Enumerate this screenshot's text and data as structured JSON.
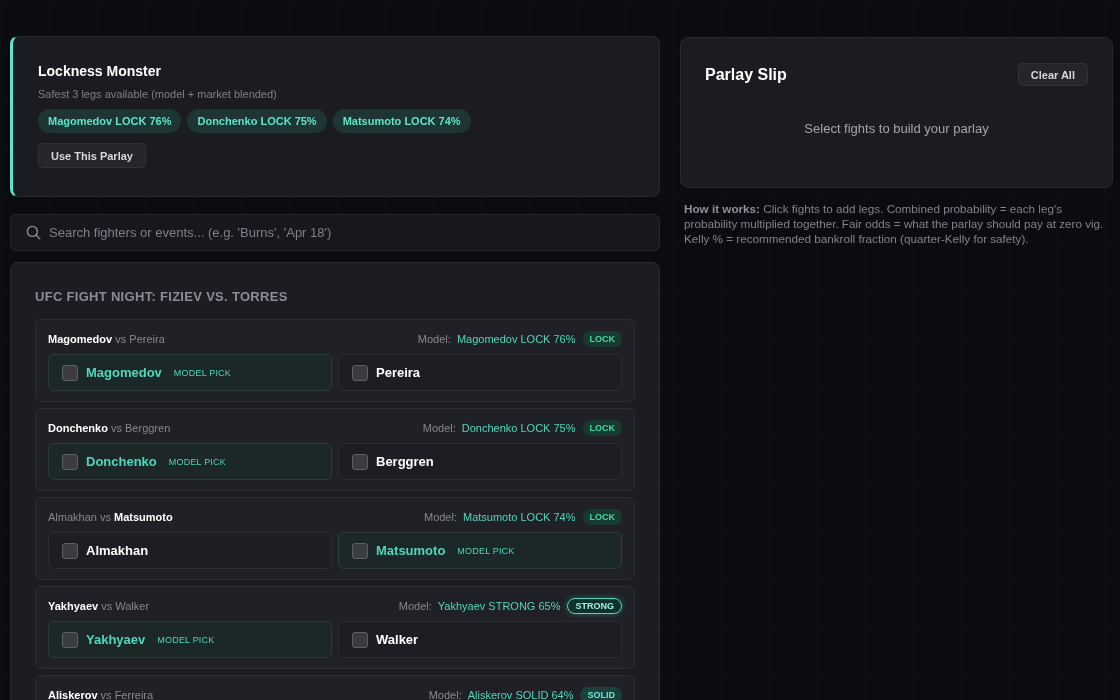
{
  "lockness": {
    "title": "Lockness Monster",
    "subtitle": "Safest 3 legs available (model + market blended)",
    "chips": [
      "Magomedov LOCK 76%",
      "Donchenko LOCK 75%",
      "Matsumoto LOCK 74%"
    ],
    "button": "Use This Parlay"
  },
  "search": {
    "placeholder": "Search fighters or events... (e.g. 'Burns', 'Apr 18')"
  },
  "event": {
    "title": "UFC FIGHT NIGHT: FIZIEV VS. TORRES",
    "fights": [
      {
        "matchup": "**Magomedov** vs Pereira",
        "model_label": "Model:",
        "model_call": "Magomedov LOCK 76%",
        "badge": {
          "kind": "lock",
          "label": "LOCK"
        },
        "options": [
          {
            "name": "Magomedov",
            "recommended": true,
            "tag": "MODEL PICK",
            "checked": false
          },
          {
            "name": "Pereira",
            "recommended": false,
            "checked": false
          }
        ]
      },
      {
        "matchup": "**Donchenko** vs Berggren",
        "model_label": "Model:",
        "model_call": "Donchenko LOCK 75%",
        "badge": {
          "kind": "lock",
          "label": "LOCK"
        },
        "options": [
          {
            "name": "Donchenko",
            "recommended": true,
            "tag": "MODEL PICK",
            "checked": false
          },
          {
            "name": "Berggren",
            "recommended": false,
            "checked": false
          }
        ]
      },
      {
        "matchup": "Almakhan vs **Matsumoto**",
        "model_label": "Model:",
        "model_call": "Matsumoto LOCK 74%",
        "badge": {
          "kind": "lock",
          "label": "LOCK"
        },
        "options": [
          {
            "name": "Almakhan",
            "recommended": false,
            "checked": false
          },
          {
            "name": "Matsumoto",
            "recommended": true,
            "tag": "MODEL PICK",
            "checked": false
          }
        ]
      },
      {
        "matchup": "**Yakhyaev** vs Walker",
        "model_label": "Model:",
        "model_call": "Yakhyaev STRONG 65%",
        "badge": {
          "kind": "strong",
          "label": "STRONG"
        },
        "options": [
          {
            "name": "Yakhyaev",
            "recommended": true,
            "tag": "MODEL PICK",
            "checked": false
          },
          {
            "name": "Walker",
            "recommended": false,
            "checked": false
          }
        ]
      },
      {
        "matchup": "**Aliskerov** vs Ferreira",
        "model_label": "Model:",
        "model_call": "Aliskerov SOLID 64%",
        "badge": {
          "kind": "solid",
          "label": "SOLID"
        }
      }
    ]
  },
  "parlay_slip": {
    "title": "Parlay Slip",
    "clear_button": "Clear All",
    "empty_message": "Select fights to build your parlay"
  },
  "help_text": "**How it works:** Click fights to add legs. Combined probability = each leg's probability multiplied together. Fair odds = what the parlay should pay at zero vig. Kelly % = recommended bankroll fraction (quarter-Kelly for safety)."
}
